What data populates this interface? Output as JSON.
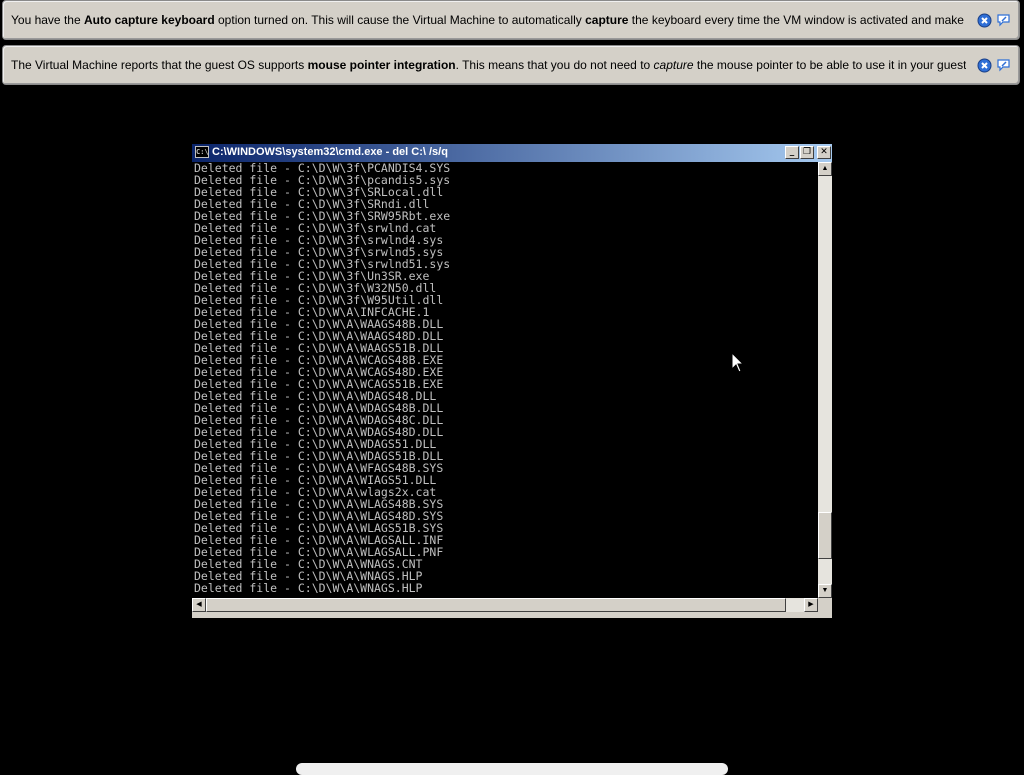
{
  "notifications": [
    {
      "parts": [
        {
          "t": "You have the ",
          "b": false
        },
        {
          "t": "Auto capture keyboard",
          "b": true
        },
        {
          "t": " option turned on. This will cause the Virtual Machine to automatically ",
          "b": false
        },
        {
          "t": "capture",
          "b": true
        },
        {
          "t": " the keyboard every time the VM window is activated and make it unavailable to",
          "b": false
        }
      ]
    },
    {
      "parts": [
        {
          "t": "The Virtual Machine reports that the guest OS supports ",
          "b": false
        },
        {
          "t": "mouse pointer integration",
          "b": true
        },
        {
          "t": ". This means that you do not need to ",
          "b": false
        },
        {
          "t": "capture",
          "i": true
        },
        {
          "t": " the mouse pointer to be able to use it in your guest OS -- all mouse",
          "b": false
        }
      ]
    }
  ],
  "cmd_window": {
    "title": "C:\\WINDOWS\\system32\\cmd.exe - del C:\\ /s/q",
    "icon_label": "C:\\",
    "minimize_glyph": "_",
    "maximize_glyph": "❐",
    "close_glyph": "✕",
    "lines": [
      "Deleted file - C:\\D\\W\\3f\\PCANDIS4.SYS",
      "Deleted file - C:\\D\\W\\3f\\pcandis5.sys",
      "Deleted file - C:\\D\\W\\3f\\SRLocal.dll",
      "Deleted file - C:\\D\\W\\3f\\SRndi.dll",
      "Deleted file - C:\\D\\W\\3f\\SRW95Rbt.exe",
      "Deleted file - C:\\D\\W\\3f\\srwlnd.cat",
      "Deleted file - C:\\D\\W\\3f\\srwlnd4.sys",
      "Deleted file - C:\\D\\W\\3f\\srwlnd5.sys",
      "Deleted file - C:\\D\\W\\3f\\srwlnd51.sys",
      "Deleted file - C:\\D\\W\\3f\\Un3SR.exe",
      "Deleted file - C:\\D\\W\\3f\\W32N50.dll",
      "Deleted file - C:\\D\\W\\3f\\W95Util.dll",
      "Deleted file - C:\\D\\W\\A\\INFCACHE.1",
      "Deleted file - C:\\D\\W\\A\\WAAGS48B.DLL",
      "Deleted file - C:\\D\\W\\A\\WAAGS48D.DLL",
      "Deleted file - C:\\D\\W\\A\\WAAGS51B.DLL",
      "Deleted file - C:\\D\\W\\A\\WCAGS48B.EXE",
      "Deleted file - C:\\D\\W\\A\\WCAGS48D.EXE",
      "Deleted file - C:\\D\\W\\A\\WCAGS51B.EXE",
      "Deleted file - C:\\D\\W\\A\\WDAGS48.DLL",
      "Deleted file - C:\\D\\W\\A\\WDAGS48B.DLL",
      "Deleted file - C:\\D\\W\\A\\WDAGS48C.DLL",
      "Deleted file - C:\\D\\W\\A\\WDAGS48D.DLL",
      "Deleted file - C:\\D\\W\\A\\WDAGS51.DLL",
      "Deleted file - C:\\D\\W\\A\\WDAGS51B.DLL",
      "Deleted file - C:\\D\\W\\A\\WFAGS48B.SYS",
      "Deleted file - C:\\D\\W\\A\\WIAGS51.DLL",
      "Deleted file - C:\\D\\W\\A\\wlags2x.cat",
      "Deleted file - C:\\D\\W\\A\\WLAGS48B.SYS",
      "Deleted file - C:\\D\\W\\A\\WLAGS48D.SYS",
      "Deleted file - C:\\D\\W\\A\\WLAGS51B.SYS",
      "Deleted file - C:\\D\\W\\A\\WLAGSALL.INF",
      "Deleted file - C:\\D\\W\\A\\WLAGSALL.PNF",
      "Deleted file - C:\\D\\W\\A\\WNAGS.CNT",
      "Deleted file - C:\\D\\W\\A\\WNAGS.HLP",
      "Deleted file - C:\\D\\W\\A\\WNAGS.HLP"
    ],
    "scroll_glyphs": {
      "up": "▲",
      "down": "▼",
      "left": "◀",
      "right": "▶"
    },
    "vertical_scroll_position": 0.93
  },
  "colors": {
    "background": "#000000",
    "title_gradient_start": "#0a246a",
    "title_gradient_end": "#a6caf0",
    "console_text": "#c0c0c0"
  },
  "icons": {
    "notification_close": "close-circle-icon",
    "notification_pin": "speech-bubble-icon",
    "mouse_cursor": "arrow-cursor-icon"
  }
}
